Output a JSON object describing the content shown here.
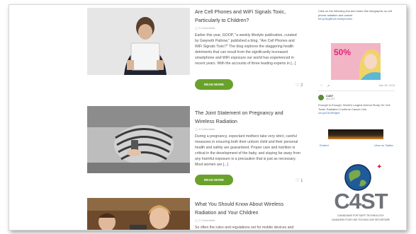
{
  "posts": [
    {
      "title": "Are Cell Phones and WiFi Signals Toxic, Particularly to Children?",
      "meta": "◯ 0 Comments",
      "excerpt": "Earlier this year, GOOP, \"a weekly lifestyle publication, curated by Gwyneth Paltrow,\" published a blog, \"Are Cell Phones and WiFi Signals Toxic?\" The blog explores the staggering health detriments that can result from the significantly increased smartphone and WiFi exposure our world has experienced in recent years. With the accounts of three leading experts in [...]",
      "read_more": "READ MORE",
      "likes": "2"
    },
    {
      "title": "The Joint Statement on Pregnancy and Wireless Radiation",
      "meta": "◯ 0 Comments",
      "excerpt": "During a pregnancy, expectant mothers take very strict, careful measures in ensuring both their unborn child and their personal health and safety are guaranteed. Proper care and nutrition is critical in the development of the baby, and staying far away from any harmful exposure is a precaution that is just as necessary. Most women are [...]",
      "read_more": "READ MORE",
      "likes": "1"
    },
    {
      "title": "What You Should Know About Wireless Radiation and Your Children",
      "meta": "◯ 0 Comments",
      "excerpt": "So often the rules and regulations set for mobile devices and"
    }
  ],
  "sidebar": {
    "tweet1_text": "Click on the following link and share this infographic on cell phone radiation and cancer",
    "tweet1_link": "bit.ly/2kq8Ew6 #cellphones",
    "promo_text": "50%",
    "tweet_date": "Mar 28, 2018",
    "tweet2_user": "C4ST",
    "tweet2_handle": "@C4ST",
    "tweet2_text": "Enough is Enough: World's Largest Animal Study On Cell Tower Radiation Confirms Cancer Link",
    "tweet2_link": "ow.ly/Z3z30Hgk6",
    "embed_label": "Embed",
    "view_label": "View on Twitter",
    "logo_text": "C4ST",
    "logo_tagline1": "CANADIANS FOR SAFE TECHNOLOGY",
    "logo_tagline2": "CANADIENS POUR UNE TECHNOLOGIE SÉCURITAIRE"
  }
}
